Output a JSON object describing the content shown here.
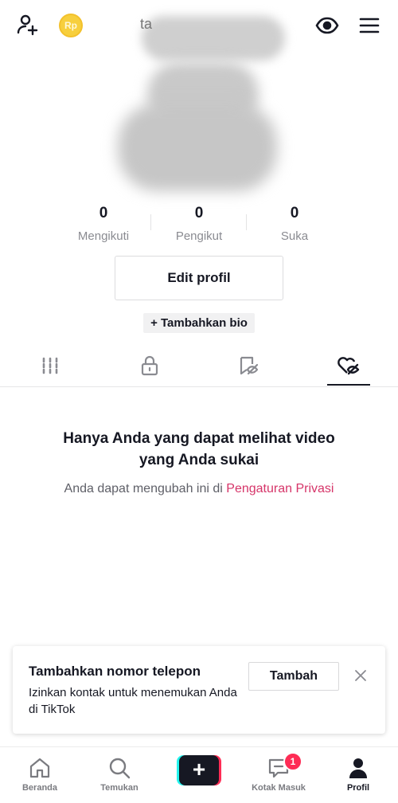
{
  "header": {
    "coin_label": "Rp",
    "username_partial": "ta",
    "icons": [
      "add-user-icon",
      "coin-icon",
      "eye-icon",
      "menu-icon"
    ]
  },
  "stats": [
    {
      "value": "0",
      "label": "Mengikuti"
    },
    {
      "value": "0",
      "label": "Pengikut"
    },
    {
      "value": "0",
      "label": "Suka"
    }
  ],
  "profile": {
    "edit_label": "Edit profil",
    "bio_label": "+ Tambahkan bio"
  },
  "tabs": [
    {
      "name": "videos",
      "icon": "grid-icon"
    },
    {
      "name": "private",
      "icon": "lock-icon"
    },
    {
      "name": "favorites",
      "icon": "bookmark-hidden-icon"
    },
    {
      "name": "liked",
      "icon": "heart-hidden-icon",
      "active": true
    }
  ],
  "empty_state": {
    "title_line1": "Hanya Anda yang dapat melihat video",
    "title_line2": "yang Anda sukai",
    "subtitle_prefix": "Anda dapat mengubah ini di ",
    "subtitle_link": "Pengaturan Privasi"
  },
  "banner": {
    "title": "Tambahkan nomor telepon",
    "text": "Izinkan kontak untuk menemukan Anda di TikTok",
    "button": "Tambah"
  },
  "nav": [
    {
      "label": "Beranda",
      "icon": "home-icon"
    },
    {
      "label": "Temukan",
      "icon": "search-icon"
    },
    {
      "label": "",
      "icon": "plus-icon"
    },
    {
      "label": "Kotak Masuk",
      "icon": "inbox-icon",
      "badge": "1"
    },
    {
      "label": "Profil",
      "icon": "profile-icon",
      "active": true
    }
  ],
  "colors": {
    "accent": "#fe2c55",
    "link": "#d63569",
    "cyan": "#25f4ee",
    "text": "#161823",
    "muted": "#8a8b91"
  }
}
